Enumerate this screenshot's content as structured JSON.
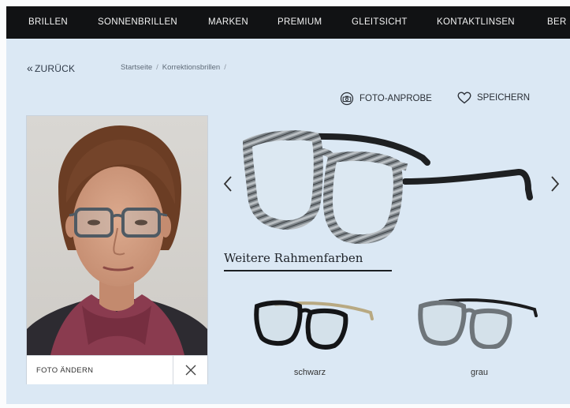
{
  "nav": {
    "items": [
      "BRILLEN",
      "SONNENBRILLEN",
      "MARKEN",
      "PREMIUM",
      "GLEITSICHT",
      "KONTAKTLINSEN",
      "BER"
    ]
  },
  "breadcrumb": {
    "back_label": "ZURÜCK",
    "items": [
      "Startseite",
      "Korrektionsbrillen"
    ]
  },
  "actions": {
    "photo_tryon": "FOTO-ANPROBE",
    "save": "SPEICHERN"
  },
  "photo": {
    "change_label": "FOTO ÄNDERN"
  },
  "colors": {
    "heading": "Weitere Rahmenfarben",
    "variants": [
      {
        "label": "schwarz"
      },
      {
        "label": "grau"
      }
    ]
  },
  "icons": {
    "back": "double-chevron-left-icon",
    "tryon": "camera-face-icon",
    "save": "heart-icon",
    "close": "close-icon",
    "prev": "chevron-left-icon",
    "next": "chevron-right-icon"
  },
  "palette": {
    "nav_bg": "#111214",
    "page_bg": "#dbe8f4"
  }
}
